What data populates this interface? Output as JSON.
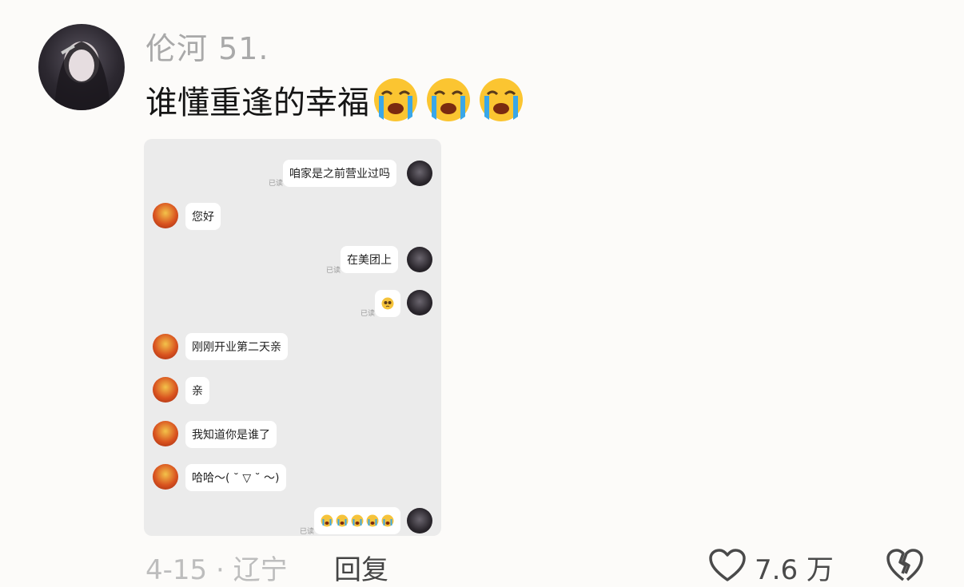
{
  "comment": {
    "username": "伦河 51.",
    "text": "谁懂重逢的幸福",
    "emoji_count": 3,
    "emoji": "loudly-crying-face"
  },
  "chat_screenshot": {
    "read_label": "已读",
    "messages": [
      {
        "side": "right",
        "text": "咱家是之前营业过吗",
        "read": true
      },
      {
        "side": "left",
        "text": "您好"
      },
      {
        "side": "right",
        "text": "在美团上",
        "read": true
      },
      {
        "side": "right",
        "text": "",
        "emoji": "pleading-face",
        "read": true
      },
      {
        "side": "left",
        "text": "刚刚开业第二天亲"
      },
      {
        "side": "left",
        "text": "亲"
      },
      {
        "side": "left",
        "text": "我知道你是谁了"
      },
      {
        "side": "left",
        "text": "哈哈～( ˘ ▽ ˘ ～)"
      },
      {
        "side": "right",
        "text": "",
        "emoji": "loudly-crying-face x5",
        "read": true
      }
    ]
  },
  "footer": {
    "date_location": "4-15 · 辽宁",
    "reply_label": "回复",
    "like_count": "7.6 万"
  },
  "colors": {
    "username": "#a9a9a9",
    "footer_meta": "#bdbdbd",
    "chat_background": "#ebebeb"
  }
}
